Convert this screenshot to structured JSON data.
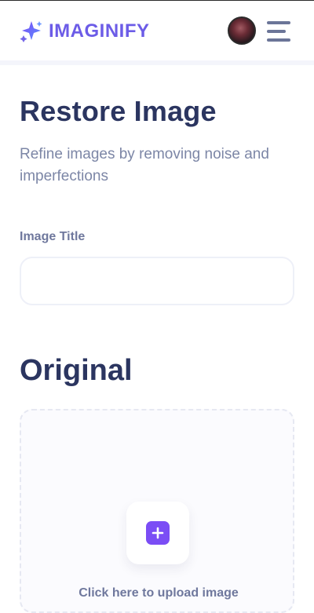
{
  "header": {
    "brand_name": "IMAGINIFY",
    "brand_color": "#6c5ce7",
    "logo_icon": "sparkle-stars-icon",
    "avatar_alt": "user avatar",
    "menu_icon": "hamburger-menu-icon"
  },
  "page": {
    "title": "Restore Image",
    "subtitle": "Refine images by removing noise and imperfections"
  },
  "form": {
    "image_title_label": "Image Title",
    "image_title_value": "",
    "image_title_placeholder": ""
  },
  "original_section": {
    "title": "Original",
    "upload_text": "Click here to upload image",
    "upload_icon": "plus-icon",
    "accent": "#7b4df5"
  }
}
